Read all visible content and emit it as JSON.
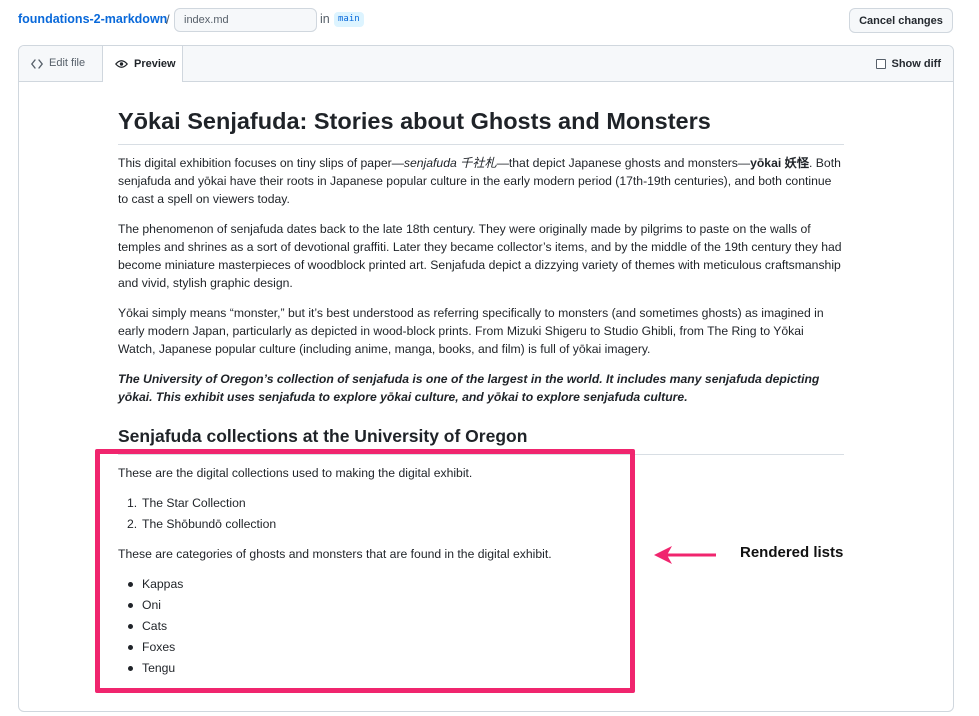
{
  "header": {
    "repo": "foundations-2-markdown",
    "separator": "/",
    "filename": "index.md",
    "in_label": "in",
    "branch": "main",
    "cancel_label": "Cancel changes"
  },
  "tabs": {
    "edit_label": "Edit file",
    "preview_label": "Preview",
    "show_diff_label": "Show diff",
    "show_diff_checked": false
  },
  "document": {
    "title": "Yōkai Senjafuda: Stories about Ghosts and Monsters",
    "p1": {
      "before": "This digital exhibition focuses on tiny slips of paper—",
      "em": "senjafuda 千社札",
      "middle": "—that depict Japanese ghosts and monsters—",
      "strong": "yōkai 妖怪",
      "after": ". Both senjafuda and yōkai have their roots in Japanese popular culture in the early modern period (17th-19th centuries), and both continue to cast a spell on viewers today."
    },
    "p2": "The phenomenon of senjafuda dates back to the late 18th century. They were originally made by pilgrims to paste on the walls of temples and shrines as a sort of devotional graffiti. Later they became collector’s items, and by the middle of the 19th century they had become miniature masterpieces of woodblock printed art. Senjafuda depict a dizzying variety of themes with meticulous craftsmanship and vivid, stylish graphic design.",
    "p3": "Yōkai simply means “monster,” but it’s best understood as referring specifically to monsters (and sometimes ghosts) as imagined in early modern Japan, particularly as depicted in wood-block prints. From Mizuki Shigeru to Studio Ghibli, from The Ring to Yōkai Watch, Japanese popular culture (including anime, manga, books, and film) is full of yōkai imagery.",
    "p4": "The University of Oregon’s collection of senjafuda is one of the largest in the world. It includes many senjafuda depicting yōkai. This exhibit uses senjafuda to explore yōkai culture, and yōkai to explore senjafuda culture.",
    "subtitle": "Senjafuda collections at the University of Oregon",
    "p5": "These are the digital collections used to making the digital exhibit.",
    "ordered_list": [
      {
        "num": "1.",
        "text": "The Star Collection"
      },
      {
        "num": "2.",
        "text": "The Shōbundō collection"
      }
    ],
    "p6": "These are categories of ghosts and monsters that are found in the digital exhibit.",
    "bullet_list": [
      "Kappas",
      "Oni",
      "Cats",
      "Foxes",
      "Tengu"
    ]
  },
  "annotation": {
    "label": "Rendered lists",
    "color": "#f0256e"
  },
  "icons": {
    "edit": "code-icon",
    "preview": "eye-icon",
    "arrow": "arrow-left-icon"
  }
}
